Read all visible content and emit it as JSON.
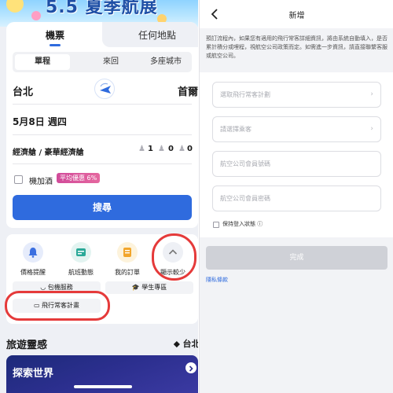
{
  "left": {
    "banner": {
      "title": "5.5 夏季航展"
    },
    "top_tabs": [
      "機票",
      "任何地點"
    ],
    "trip_types": [
      "單程",
      "來回",
      "多座城市"
    ],
    "origin": "台北",
    "destination": "首爾",
    "depart_date": "5月8日 週四",
    "cabin": "經濟艙 / 豪華經濟艙",
    "passengers": {
      "adults": "1",
      "children": "0",
      "infants": "0"
    },
    "addon": {
      "label": "機加酒",
      "badge": "平均優惠 6%"
    },
    "search_label": "搜尋",
    "quick_actions": [
      {
        "label": "價格提醒",
        "icon": "bell-icon"
      },
      {
        "label": "航班動態",
        "icon": "flight-status-icon"
      },
      {
        "label": "我的訂單",
        "icon": "orders-icon"
      },
      {
        "label": "顯示較少",
        "icon": "chevron-up-icon"
      }
    ],
    "services": {
      "wifi": "包機服務",
      "student": "學生專區",
      "frequent_flyer": "飛行常客計畫"
    },
    "travel_section": {
      "title": "旅遊靈感",
      "location": "台北"
    },
    "explore_title": "探索世界",
    "accent_color": "#2f6bde",
    "highlight_color": "#e53a3a"
  },
  "right": {
    "nav_title": "新增",
    "notice": "預訂流程內，如果您有適用的飛行常客詳細資訊，將由系統自動填入，是否累計積分或哩程，視航空公司政策而定。如需進一步資訊，請直接聯繫客服或航空公司。",
    "fields": {
      "program": "選取飛行常客計劃",
      "passenger": "請選擇乘客",
      "member_number": "航空公司會員號碼",
      "member_password": "航空公司會員密碼"
    },
    "keep_logged_in": "保持登入狀態 ⓘ",
    "done_label": "完成",
    "privacy_link": "隱私條款"
  }
}
